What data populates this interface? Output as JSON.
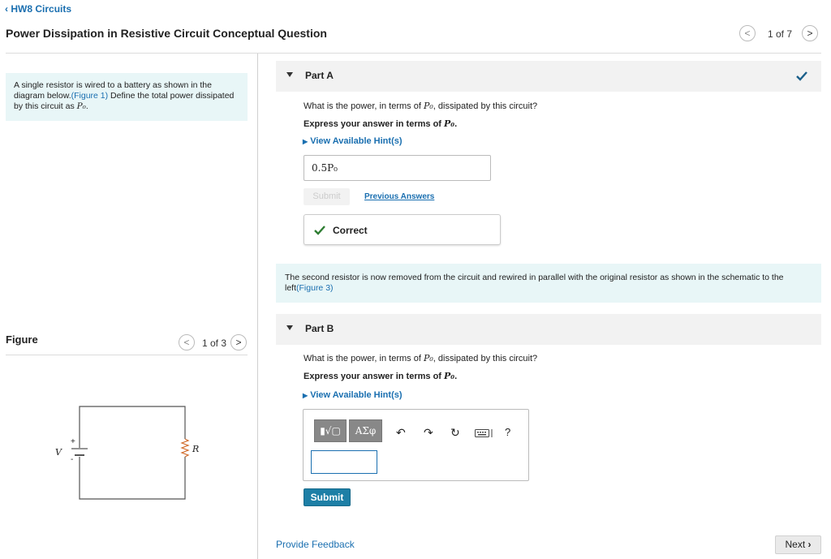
{
  "header": {
    "back_label": "HW8 Circuits",
    "title": "Power Dissipation in Resistive Circuit Conceptual Question",
    "pager": "1 of 7"
  },
  "intro": {
    "text_1": "A single resistor is wired to a battery as shown in the diagram below.",
    "figure_link": "(Figure 1)",
    "text_2": " Define the total power dissipated by this circuit as ",
    "symbol": "P₀",
    "text_3": "."
  },
  "figure": {
    "label": "Figure",
    "pager": "1 of 3",
    "battery_label": "V",
    "resistor_label": "R",
    "plus_sign": "+",
    "minus_sign": "-"
  },
  "partA": {
    "label": "Part A",
    "question_pre": "What is the power, in terms of ",
    "question_symbol": "P₀",
    "question_post": ", dissipated by this circuit?",
    "instruction_pre": "Express your answer in terms of ",
    "instruction_symbol": "P₀",
    "instruction_post": ".",
    "hint_label": "View Available Hint(s)",
    "answer": "0.5P₀",
    "submit_label": "Submit",
    "previous_answers_label": "Previous Answers",
    "result_label": "Correct"
  },
  "info_box": {
    "text": "The second resistor is now removed from the circuit and rewired in parallel with the original resistor as shown in the schematic to the left",
    "figure_link": "(Figure 3)"
  },
  "partB": {
    "label": "Part B",
    "question_pre": "What is the power, in terms of ",
    "question_symbol": "P₀",
    "question_post": ", dissipated by this circuit?",
    "instruction_pre": "Express your answer in terms of ",
    "instruction_symbol": "P₀",
    "instruction_post": ".",
    "hint_label": "View Available Hint(s)",
    "toolbar_templates_label": "▮√▢",
    "toolbar_greek_label": "ΑΣφ",
    "help_label": "?",
    "submit_label": "Submit"
  },
  "footer": {
    "feedback_label": "Provide Feedback",
    "next_label": "Next"
  },
  "colors": {
    "accent": "#1a6fb0",
    "submit": "#1d7fa6",
    "correct_check": "#2e7d32",
    "info_bg": "#e8f6f7"
  }
}
